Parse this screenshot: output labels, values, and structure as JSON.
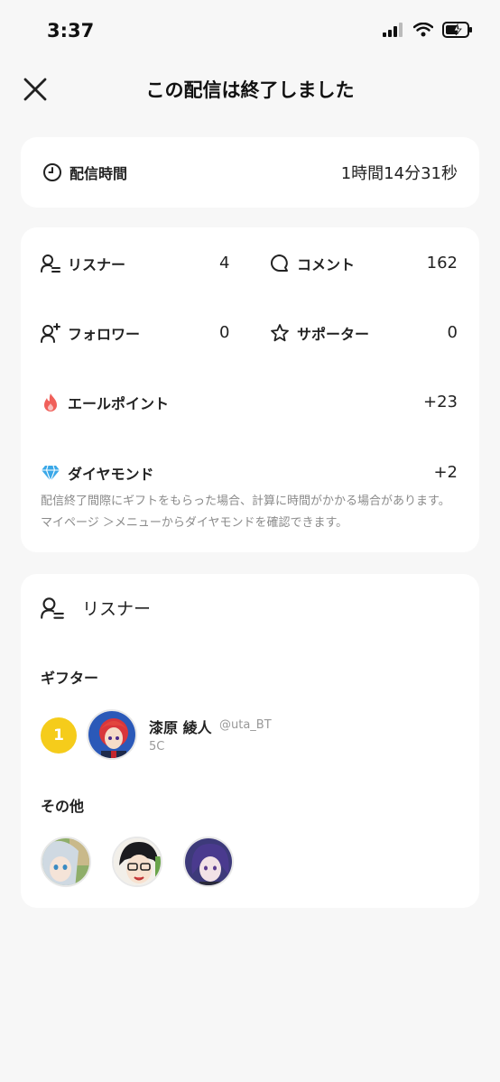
{
  "status_bar": {
    "time": "3:37"
  },
  "header": {
    "title": "この配信は終了しました"
  },
  "duration": {
    "label": "配信時間",
    "value": "1時間14分31秒"
  },
  "stats": {
    "listeners": {
      "label": "リスナー",
      "value": "4"
    },
    "comments": {
      "label": "コメント",
      "value": "162"
    },
    "followers": {
      "label": "フォロワー",
      "value": "0"
    },
    "supporters": {
      "label": "サポーター",
      "value": "0"
    },
    "yell_points": {
      "label": "エールポイント",
      "value": "+23"
    },
    "diamonds": {
      "label": "ダイヤモンド",
      "value": "+2"
    },
    "note": "配信終了間際にギフトをもらった場合、計算に時間がかかる場合があります。マイページ ＞メニューからダイヤモンドを確認できます。"
  },
  "listeners_section": {
    "title": "リスナー",
    "gifters_heading": "ギフター",
    "gifters": [
      {
        "rank": "1",
        "name": "漆原 綾人",
        "handle": "@uta_BT",
        "amount": "5C"
      }
    ],
    "others_heading": "その他"
  },
  "colors": {
    "accent_yellow": "#f5cc1b",
    "flame": "#f0605a",
    "diamond": "#3aa8e8",
    "background": "#f7f7f7"
  }
}
